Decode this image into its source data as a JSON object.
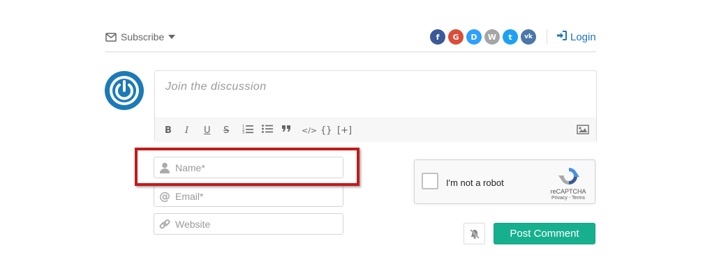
{
  "header": {
    "subscribe_label": "Subscribe",
    "social_buttons": [
      {
        "icon": "facebook-icon",
        "glyph": "f",
        "color": "#3b5998"
      },
      {
        "icon": "google-icon",
        "glyph": "G",
        "color": "#dd4b39"
      },
      {
        "icon": "disqus-icon",
        "glyph": "D",
        "color": "#2e9fff"
      },
      {
        "icon": "wordpress-icon",
        "glyph": "W",
        "color": "#a5a5a5"
      },
      {
        "icon": "twitter-icon",
        "glyph": "t",
        "color": "#1da1f2"
      },
      {
        "icon": "vk-icon",
        "glyph": "vk",
        "color": "#4a76a8"
      }
    ],
    "login_label": "Login"
  },
  "editor": {
    "placeholder": "Join the discussion",
    "toolbar": {
      "bold": "B",
      "italic": "I",
      "underline": "U",
      "strike": "S",
      "code_inline": "</>",
      "code_block": "{}",
      "spoiler": "[+]"
    }
  },
  "form": {
    "name_placeholder": "Name*",
    "email_placeholder": "Email*",
    "website_placeholder": "Website"
  },
  "recaptcha": {
    "label": "I'm not a robot",
    "brand": "reCAPTCHA",
    "links": "Privacy - Terms"
  },
  "actions": {
    "post_label": "Post Comment"
  },
  "colors": {
    "accent": "#17b08f",
    "link": "#1e73be",
    "highlight": "#c41a1a"
  }
}
